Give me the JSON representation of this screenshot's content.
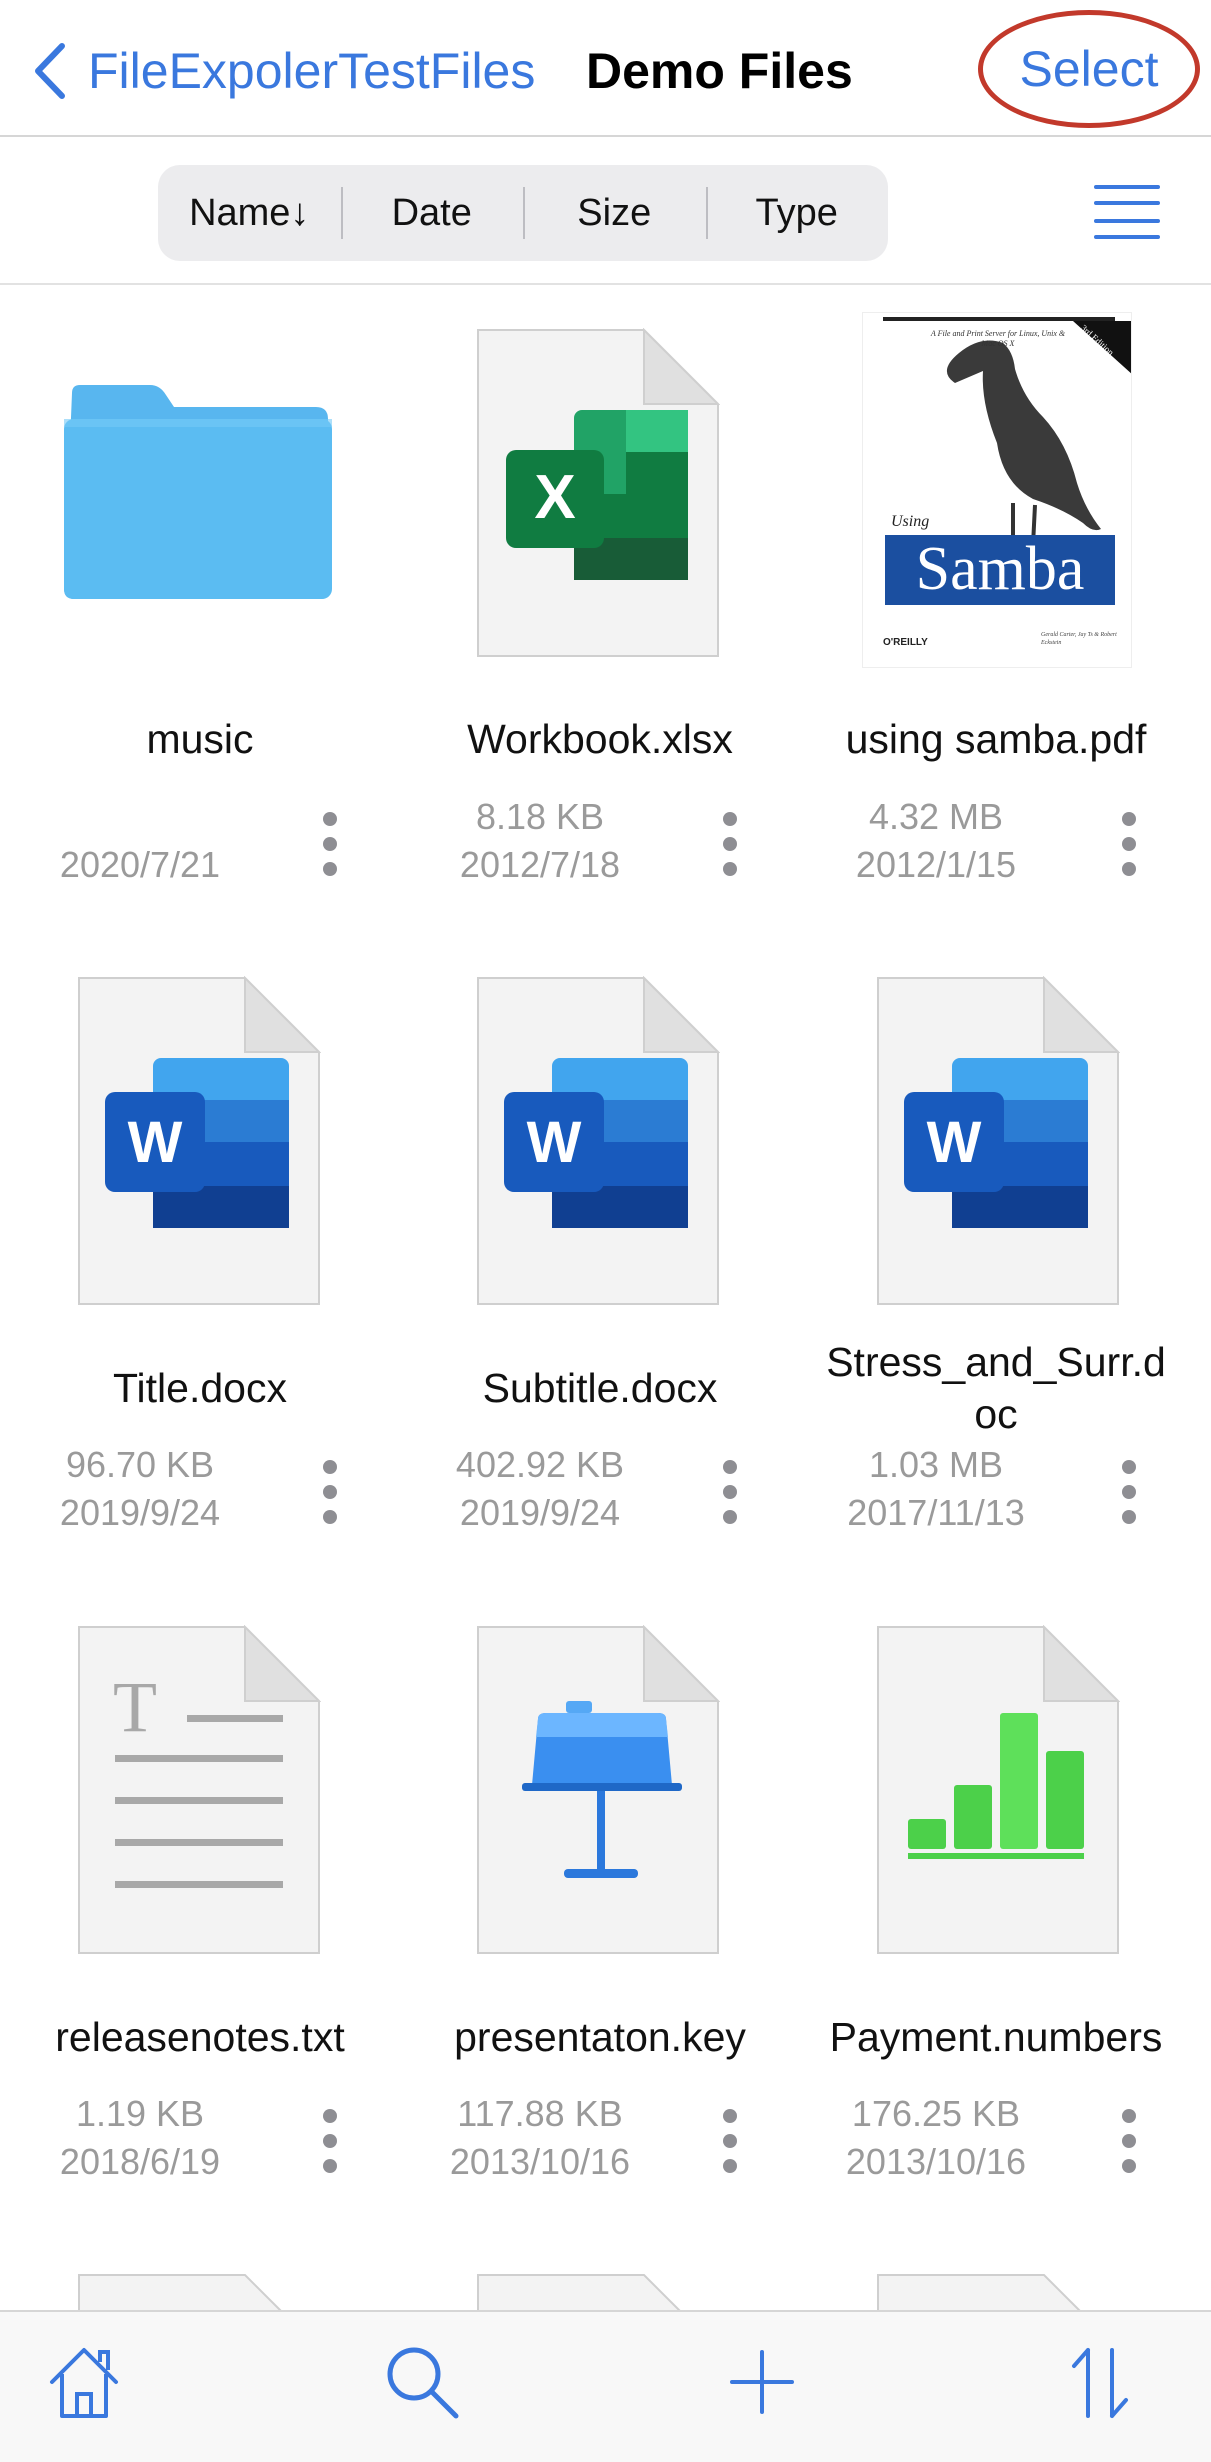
{
  "navbar": {
    "back_label": "FileExpolerTestFiles",
    "title": "Demo Files",
    "select_label": "Select"
  },
  "sort": {
    "options": [
      "Name↓",
      "Date",
      "Size",
      "Type"
    ]
  },
  "files": [
    {
      "name": "music",
      "size": "",
      "date": "2020/7/21",
      "icon": "folder-icon"
    },
    {
      "name": "Workbook.xlsx",
      "size": "8.18 KB",
      "date": "2012/7/18",
      "icon": "excel-icon"
    },
    {
      "name": "using samba.pdf",
      "size": "4.32 MB",
      "date": "2012/1/15",
      "icon": "pdf-thumbnail"
    },
    {
      "name": "Title.docx",
      "size": "96.70 KB",
      "date": "2019/9/24",
      "icon": "word-icon"
    },
    {
      "name": "Subtitle.docx",
      "size": "402.92 KB",
      "date": "2019/9/24",
      "icon": "word-icon"
    },
    {
      "name": "Stress_and_Surr.d\noc",
      "size": "1.03 MB",
      "date": "2017/11/13",
      "icon": "word-icon"
    },
    {
      "name": "releasenotes.txt",
      "size": "1.19 KB",
      "date": "2018/6/19",
      "icon": "text-file-icon"
    },
    {
      "name": "presentaton.key",
      "size": "117.88 KB",
      "date": "2013/10/16",
      "icon": "keynote-icon"
    },
    {
      "name": "Payment.numbers",
      "size": "176.25 KB",
      "date": "2013/10/16",
      "icon": "numbers-icon"
    }
  ],
  "pdf_cover": {
    "tagline": "A File and Print Server for Linux, Unix & Mac OS X",
    "edition": "3rd Edition",
    "using": "Using",
    "title": "Samba",
    "publisher": "O'REILLY",
    "authors": "Gerald Carter, Jay Ts & Robert Eckstein"
  },
  "tabbar": {
    "items": [
      "home-icon",
      "search-icon",
      "add-icon",
      "sort-icon"
    ]
  },
  "colors": {
    "accent": "#3a78de",
    "select_highlight": "#c2392b",
    "folder": "#5bbcf2",
    "excel": "#1f7244",
    "word": "#2b5cb8",
    "numbers": "#4cd04a",
    "keynote": "#3a8ff0"
  }
}
